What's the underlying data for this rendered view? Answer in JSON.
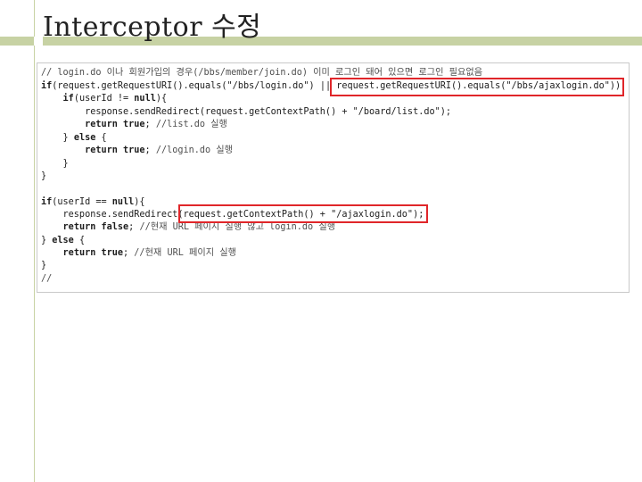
{
  "slide": {
    "title": "Interceptor 수정"
  },
  "colors": {
    "accent_bar": "#c7d2a4",
    "highlight_border": "#e0262a"
  },
  "code": {
    "lines": [
      [
        {
          "t": "// login.do 이나 회원가입의 경우(/bbs/member/join.do) 이미 로그인 돼어 있으면 로그인 필요없음",
          "c": "cmt"
        }
      ],
      [
        {
          "t": "if",
          "c": "kw"
        },
        {
          "t": "(request.getRequestURI().equals(\"/bbs/login.do\") || request.getRequestURI().equals(\"/bbs/ajaxlogin.do\"))",
          "c": ""
        }
      ],
      [
        {
          "t": "    ",
          "c": ""
        },
        {
          "t": "if",
          "c": "kw"
        },
        {
          "t": "(userId != ",
          "c": ""
        },
        {
          "t": "null",
          "c": "kw"
        },
        {
          "t": "){",
          "c": ""
        }
      ],
      [
        {
          "t": "        response.sendRedirect(request.getContextPath() + \"/board/list.do\");",
          "c": ""
        }
      ],
      [
        {
          "t": "        ",
          "c": ""
        },
        {
          "t": "return true",
          "c": "kw"
        },
        {
          "t": "; ",
          "c": ""
        },
        {
          "t": "//list.do 실행",
          "c": "cmt"
        }
      ],
      [
        {
          "t": "    } ",
          "c": ""
        },
        {
          "t": "else",
          "c": "kw"
        },
        {
          "t": " {",
          "c": ""
        }
      ],
      [
        {
          "t": "        ",
          "c": ""
        },
        {
          "t": "return true",
          "c": "kw"
        },
        {
          "t": "; ",
          "c": ""
        },
        {
          "t": "//login.do 실행",
          "c": "cmt"
        }
      ],
      [
        {
          "t": "    }",
          "c": ""
        }
      ],
      [
        {
          "t": "}",
          "c": ""
        }
      ],
      [
        {
          "t": "",
          "c": ""
        }
      ],
      [
        {
          "t": "if",
          "c": "kw"
        },
        {
          "t": "(userId == ",
          "c": ""
        },
        {
          "t": "null",
          "c": "kw"
        },
        {
          "t": "){",
          "c": ""
        }
      ],
      [
        {
          "t": "    response.sendRedirect(request.getContextPath() + \"/ajaxlogin.do\");",
          "c": ""
        }
      ],
      [
        {
          "t": "    ",
          "c": ""
        },
        {
          "t": "return false",
          "c": "kw"
        },
        {
          "t": "; ",
          "c": ""
        },
        {
          "t": "//현재 URL 페이지 실행 않고 login.do 실행",
          "c": "cmt"
        }
      ],
      [
        {
          "t": "} ",
          "c": ""
        },
        {
          "t": "else",
          "c": "kw"
        },
        {
          "t": " {",
          "c": ""
        }
      ],
      [
        {
          "t": "    ",
          "c": ""
        },
        {
          "t": "return true",
          "c": "kw"
        },
        {
          "t": "; ",
          "c": ""
        },
        {
          "t": "//현재 URL 페이지 실행",
          "c": "cmt"
        }
      ],
      [
        {
          "t": "}",
          "c": ""
        }
      ],
      [
        {
          "t": "//",
          "c": "cmt"
        }
      ]
    ]
  }
}
